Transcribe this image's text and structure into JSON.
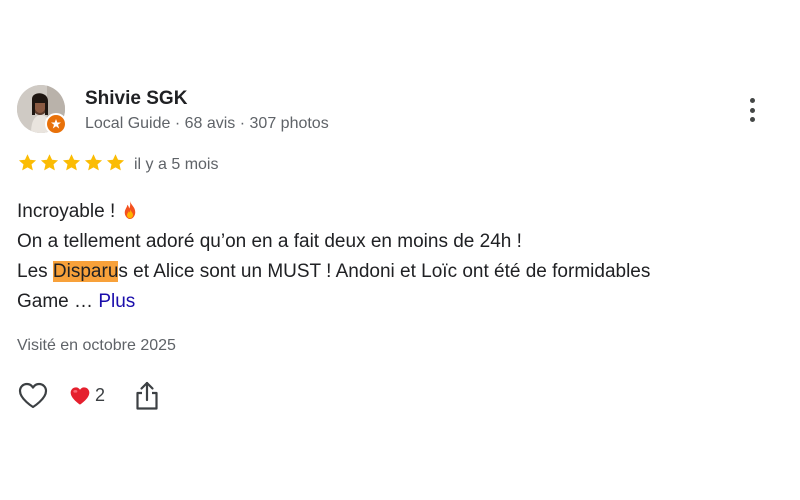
{
  "author": {
    "name": "Shivie SGK",
    "meta": "Local Guide · 68 avis · 307 photos",
    "avatar_icon": "profile-photo",
    "badge_icon": "local-guide-star-icon",
    "badge_color": "#e8710a"
  },
  "menu_icon": "more-vert-icon",
  "rating": {
    "stars": 5,
    "max": 5,
    "star_color": "#fbbc04",
    "date": "il y a 5 mois"
  },
  "text": {
    "line1": "Incroyable ! ",
    "line1_emoji": "fire-icon",
    "line2": "On a tellement adoré qu’on en a fait deux en moins de 24h !",
    "line3_before": "Les ",
    "line3_highlight": "Disparu",
    "line3_after": "s et Alice sont un MUST ! Andoni et Loïc ont été de formidables",
    "line4": "Game … ",
    "more_link": "Plus",
    "highlight_color": "#f8a13a"
  },
  "visited": "Visité en octobre 2025",
  "actions": {
    "like_icon": "heart-outline-icon",
    "reaction_icon": "red-heart-icon",
    "reaction_count": "2",
    "share_icon": "share-icon"
  }
}
